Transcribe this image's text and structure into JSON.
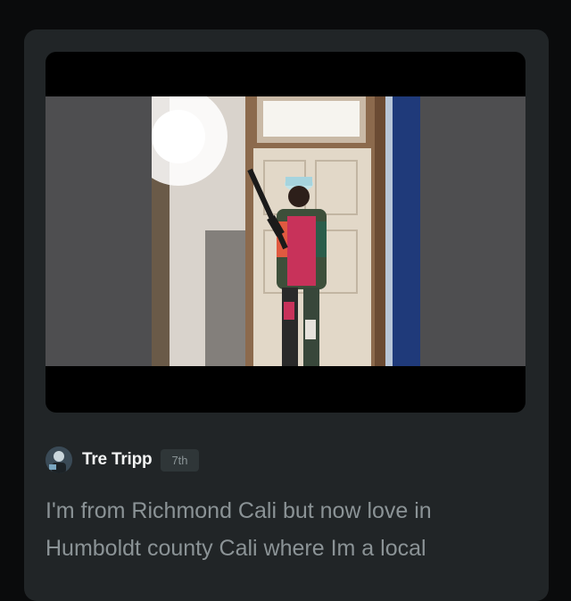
{
  "post": {
    "author": {
      "name": "Tre Tripp",
      "avatar_icon": "user-avatar"
    },
    "timestamp": "7th",
    "text": "I'm from Richmond Cali but now love in Humboldt county Cali where Im a local",
    "media": {
      "type": "photo",
      "icon": "photo-image"
    }
  },
  "colors": {
    "background": "#0a0b0c",
    "card": "#212527",
    "name": "#f2f3f3",
    "body_text": "#8b9396",
    "badge_bg": "#2f3638"
  }
}
